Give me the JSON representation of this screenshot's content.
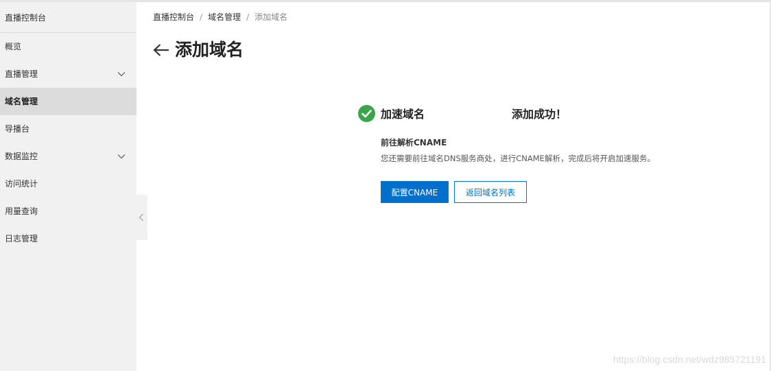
{
  "sidebar": {
    "title": "直播控制台",
    "items": [
      {
        "label": "概览"
      },
      {
        "label": "直播管理"
      },
      {
        "label": "域名管理"
      },
      {
        "label": "导播台"
      },
      {
        "label": "数据监控"
      },
      {
        "label": "访问统计"
      },
      {
        "label": "用量查询"
      },
      {
        "label": "日志管理"
      }
    ]
  },
  "breadcrumb": {
    "items": [
      "直播控制台",
      "域名管理",
      "添加域名"
    ],
    "separator": "/"
  },
  "header": {
    "title": "添加域名"
  },
  "result": {
    "domain_label": "加速域名",
    "status": "添加成功！",
    "next_title": "前往解析CNAME",
    "next_desc": "您还需要前往域名DNS服务商处，进行CNAME解析，完成后将开启加速服务。"
  },
  "buttons": {
    "primary": "配置CNAME",
    "secondary": "返回域名列表"
  },
  "watermark": "https://blog.csdn.net/wdz985721191",
  "colors": {
    "accent": "#0070cc",
    "success": "#3aa64b",
    "sidebar_bg": "#f1f1f1",
    "sidebar_active": "#dcdcdc"
  },
  "icons": {
    "back": "arrow-left-icon",
    "success": "check-circle-icon",
    "expand": "chevron-down-icon",
    "collapse": "chevron-left-icon"
  }
}
